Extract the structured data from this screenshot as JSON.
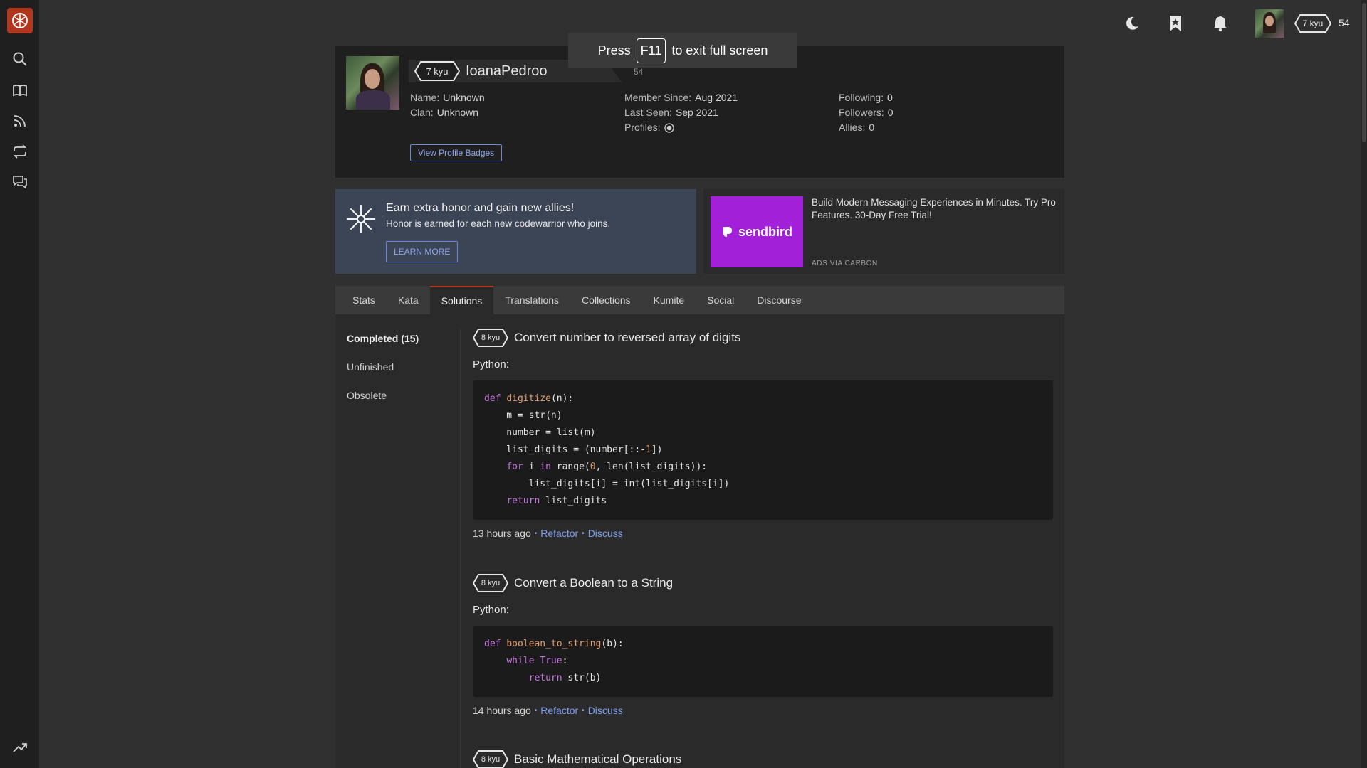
{
  "rail": {
    "logo": "codewars-logo",
    "items": [
      {
        "icon": "search-icon"
      },
      {
        "icon": "book-icon"
      },
      {
        "icon": "rss-icon"
      },
      {
        "icon": "repeat-icon"
      },
      {
        "icon": "chat-icon"
      }
    ],
    "bottom_icon": "trending-icon"
  },
  "topbar": {
    "rank": "7 kyu",
    "honor": "54"
  },
  "fullscreen_notice": {
    "prefix": "Press",
    "key": "F11",
    "suffix": "to exit full screen"
  },
  "profile": {
    "rank": "7 kyu",
    "username": "IoanaPedroo",
    "honor": "54",
    "col1": [
      {
        "label": "Name:",
        "value": "Unknown"
      },
      {
        "label": "Clan:",
        "value": "Unknown"
      }
    ],
    "col2": [
      {
        "label": "Member Since:",
        "value": "Aug 2021"
      },
      {
        "label": "Last Seen:",
        "value": "Sep 2021"
      },
      {
        "label": "Profiles:",
        "value": ""
      }
    ],
    "col3": [
      {
        "label": "Following:",
        "value": "0"
      },
      {
        "label": "Followers:",
        "value": "0"
      },
      {
        "label": "Allies:",
        "value": "0"
      }
    ],
    "badges_button": "View Profile Badges"
  },
  "promo": {
    "title": "Earn extra honor and gain new allies!",
    "subtitle": "Honor is earned for each new codewarrior who joins.",
    "button": "LEARN MORE"
  },
  "ad": {
    "brand": "sendbird",
    "text": "Build Modern Messaging Experiences in Minutes. Try Pro Features. 30-Day Free Trial!",
    "via": "ADS VIA CARBON"
  },
  "tabs": [
    "Stats",
    "Kata",
    "Solutions",
    "Translations",
    "Collections",
    "Kumite",
    "Social",
    "Discourse"
  ],
  "active_tab": "Solutions",
  "side_menu": [
    "Completed (15)",
    "Unfinished",
    "Obsolete"
  ],
  "solutions": [
    {
      "rank": "8 kyu",
      "title": "Convert number to reversed array of digits",
      "language": "Python:",
      "time": "13 hours ago",
      "refactor": "Refactor",
      "discuss": "Discuss"
    },
    {
      "rank": "8 kyu",
      "title": "Convert a Boolean to a String",
      "language": "Python:",
      "time": "14 hours ago",
      "refactor": "Refactor",
      "discuss": "Discuss"
    },
    {
      "rank": "8 kyu",
      "title": "Basic Mathematical Operations"
    }
  ],
  "colors": {
    "brand_red": "#b1361e",
    "link_blue": "#7f9ff0",
    "promo_bg": "#3c4556",
    "ad_purple": "#a220d8"
  }
}
